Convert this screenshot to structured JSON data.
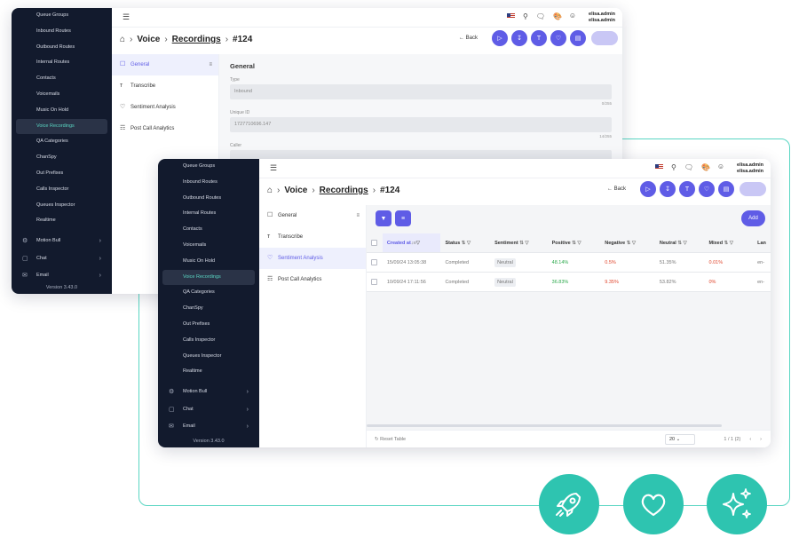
{
  "colors": {
    "accent": "#5f5ce6",
    "teal": "#2ec4b0",
    "sidebar_bg": "#121a2d"
  },
  "back_window": {
    "sidebar": {
      "items": [
        {
          "label": "Queue Groups",
          "active": false
        },
        {
          "label": "Inbound Routes",
          "active": false
        },
        {
          "label": "Outbound Routes",
          "active": false
        },
        {
          "label": "Internal Routes",
          "active": false
        },
        {
          "label": "Contacts",
          "active": false
        },
        {
          "label": "Voicemails",
          "active": false
        },
        {
          "label": "Music On Hold",
          "active": false
        },
        {
          "label": "Voice Recordings",
          "active": true
        },
        {
          "label": "QA Categories",
          "active": false
        },
        {
          "label": "ChanSpy",
          "active": false
        },
        {
          "label": "Out Prefixes",
          "active": false
        },
        {
          "label": "Calls Inspector",
          "active": false
        },
        {
          "label": "Queues Inspector",
          "active": false
        },
        {
          "label": "Realtime",
          "active": false
        }
      ],
      "groups": [
        {
          "label": "Motion Bull",
          "icon": "motion-bull-icon"
        },
        {
          "label": "Chat",
          "icon": "chat-icon"
        },
        {
          "label": "Email",
          "icon": "email-icon"
        }
      ],
      "version": "Version 3.43.0"
    },
    "topbar": {
      "user_line1": "elisa.admin",
      "user_line2": "elisa.admin"
    },
    "breadcrumb": {
      "section": "Voice",
      "page": "Recordings",
      "id": "#124"
    },
    "back_label": "Back",
    "nav": [
      {
        "label": "General",
        "icon": "mic-icon",
        "active": true
      },
      {
        "label": "Transcribe",
        "icon": "text-icon",
        "active": false
      },
      {
        "label": "Sentiment Analysis",
        "icon": "heart-icon",
        "active": false
      },
      {
        "label": "Post Call Analytics",
        "icon": "chart-icon",
        "active": false
      }
    ],
    "form": {
      "title": "General",
      "fields": [
        {
          "label": "Type",
          "value": "Inbound",
          "count": "0/255"
        },
        {
          "label": "Unique ID",
          "value": "1727710696.147",
          "count": "14/255"
        },
        {
          "label": "Caller",
          "value": "",
          "count": ""
        }
      ]
    }
  },
  "front_window": {
    "sidebar": {
      "items": [
        {
          "label": "Queue Groups",
          "active": false
        },
        {
          "label": "Inbound Routes",
          "active": false
        },
        {
          "label": "Outbound Routes",
          "active": false
        },
        {
          "label": "Internal Routes",
          "active": false
        },
        {
          "label": "Contacts",
          "active": false
        },
        {
          "label": "Voicemails",
          "active": false
        },
        {
          "label": "Music On Hold",
          "active": false
        },
        {
          "label": "Voice Recordings",
          "active": true
        },
        {
          "label": "QA Categories",
          "active": false
        },
        {
          "label": "ChanSpy",
          "active": false
        },
        {
          "label": "Out Prefixes",
          "active": false
        },
        {
          "label": "Calls Inspector",
          "active": false
        },
        {
          "label": "Queues Inspector",
          "active": false
        },
        {
          "label": "Realtime",
          "active": false
        }
      ],
      "groups": [
        {
          "label": "Motion Bull",
          "icon": "motion-bull-icon"
        },
        {
          "label": "Chat",
          "icon": "chat-icon"
        },
        {
          "label": "Email",
          "icon": "email-icon"
        }
      ],
      "version": "Version 3.43.0"
    },
    "topbar": {
      "user_line1": "elisa.admin",
      "user_line2": "elisa.admin"
    },
    "breadcrumb": {
      "section": "Voice",
      "page": "Recordings",
      "id": "#124"
    },
    "back_label": "Back",
    "nav": [
      {
        "label": "General",
        "icon": "mic-icon",
        "active": false
      },
      {
        "label": "Transcribe",
        "icon": "text-icon",
        "active": false
      },
      {
        "label": "Sentiment Analysis",
        "icon": "heart-icon",
        "active": true
      },
      {
        "label": "Post Call Analytics",
        "icon": "chart-icon",
        "active": false
      }
    ],
    "table": {
      "add_label": "Add",
      "columns": [
        "Created at",
        "Status",
        "Sentiment",
        "Positive",
        "Negative",
        "Neutral",
        "Mixed",
        "Lan"
      ],
      "rows": [
        {
          "created": "15/09/24 13:05:38",
          "status": "Completed",
          "sentiment": "Neutral",
          "positive": "48.14%",
          "negative": "0.5%",
          "neutral": "51.35%",
          "mixed": "0.01%",
          "lang": "en-"
        },
        {
          "created": "10/09/24 17:11:56",
          "status": "Completed",
          "sentiment": "Neutral",
          "positive": "36.83%",
          "negative": "9.35%",
          "neutral": "53.82%",
          "mixed": "0%",
          "lang": "en-"
        }
      ],
      "reset_label": "Reset Table",
      "per_page": "20",
      "pagination": "1 / 1 (2)"
    }
  },
  "badges": [
    {
      "name": "rocket-icon"
    },
    {
      "name": "heart-icon"
    },
    {
      "name": "sparkles-icon"
    }
  ]
}
